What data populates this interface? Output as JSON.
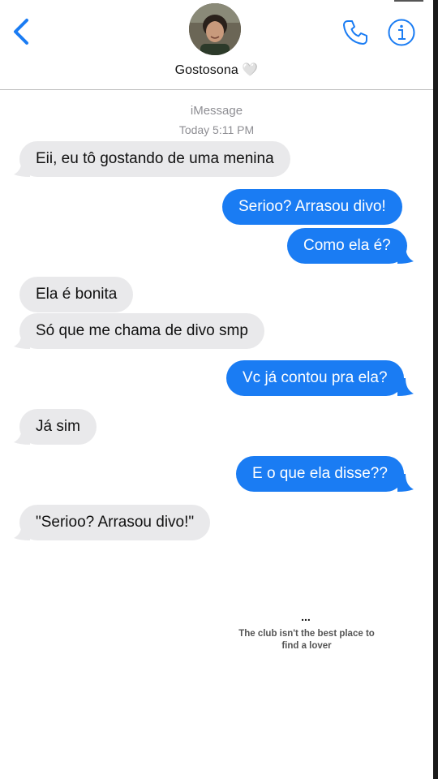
{
  "header": {
    "contact_name": "Gostosona 🤍",
    "back_icon": "chevron-left-icon",
    "phone_icon": "phone-icon",
    "info_icon": "info-icon",
    "accent_color": "#1a7cf3"
  },
  "thread": {
    "service_label": "iMessage",
    "timestamp": "Today 5:11 PM"
  },
  "messages": [
    {
      "direction": "incoming",
      "text": "Eii, eu tô gostando de uma menina"
    },
    {
      "direction": "outgoing",
      "text": "Serioo? Arrasou divo!"
    },
    {
      "direction": "outgoing",
      "text": "Como ela é?"
    },
    {
      "direction": "incoming",
      "text": "Ela é bonita"
    },
    {
      "direction": "incoming",
      "text": "Só que me chama de divo smp"
    },
    {
      "direction": "outgoing",
      "text": "Vc já contou pra ela?"
    },
    {
      "direction": "incoming",
      "text": "Já sim"
    },
    {
      "direction": "outgoing",
      "text": "E o que ela disse??"
    },
    {
      "direction": "incoming",
      "text": "\"Serioo? Arrasou divo!\""
    }
  ],
  "footer": {
    "ellipsis": "...",
    "caption": "The club isn't the best place to find a lover"
  }
}
